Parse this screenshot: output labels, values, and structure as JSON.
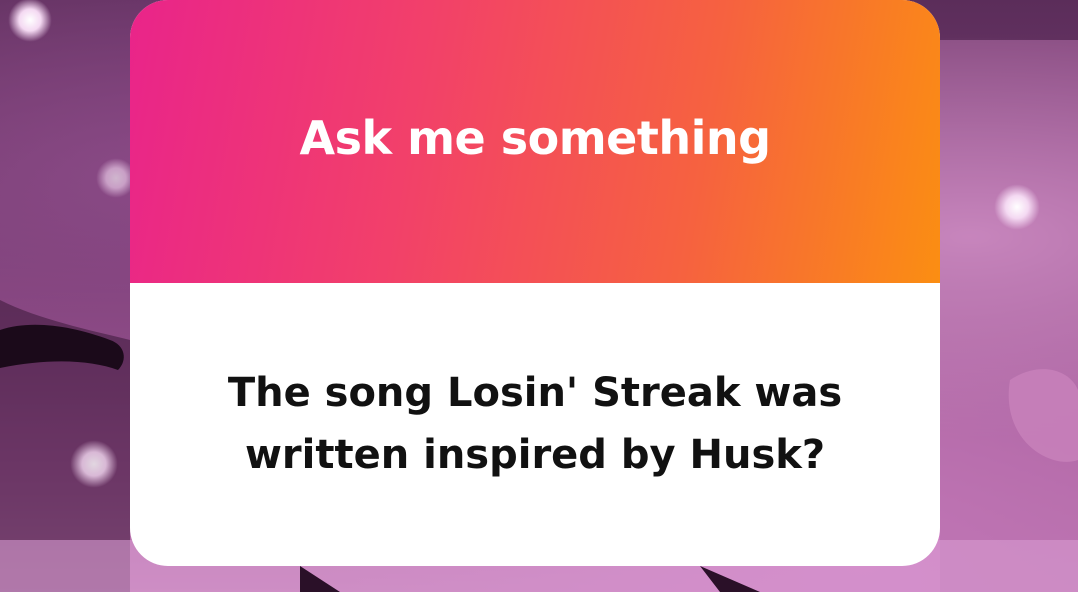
{
  "question_card": {
    "header_title": "Ask me something",
    "question_line_1": "The song Losin' Streak was",
    "question_line_2": "written inspired by Husk?"
  },
  "colors": {
    "header_gradient_start": "#e9248a",
    "header_gradient_end": "#fb8e12",
    "body_background": "#ffffff",
    "title_text": "#ffffff",
    "question_text": "#111111"
  }
}
